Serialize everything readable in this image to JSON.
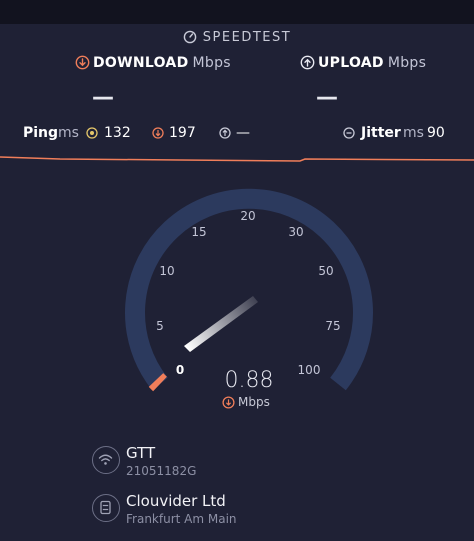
{
  "brand": {
    "icon": "gauge-icon",
    "label": "SPEEDTEST"
  },
  "download": {
    "icon": "download-arrow-icon",
    "label": "DOWNLOAD",
    "unit": "Mbps",
    "value": "—",
    "color": "#f07e5a"
  },
  "upload": {
    "icon": "upload-arrow-icon",
    "label": "UPLOAD",
    "unit": "Mbps",
    "value": "—"
  },
  "ping": {
    "label": "Ping",
    "unit": "ms",
    "idle": {
      "icon": "idle-latency-icon",
      "value": "132",
      "color": "#e4c66a"
    },
    "download": {
      "icon": "download-latency-icon",
      "value": "197",
      "color": "#f07e5a"
    },
    "upload": {
      "icon": "upload-latency-icon",
      "value": "—"
    }
  },
  "jitter": {
    "icon": "jitter-icon",
    "label": "Jitter",
    "unit": "ms",
    "value": "90"
  },
  "gauge": {
    "ticks": [
      "0",
      "5",
      "10",
      "15",
      "20",
      "30",
      "50",
      "75",
      "100"
    ],
    "speed": "0.88",
    "unit": "Mbps",
    "accent": "#f07e5a",
    "track": "#2c3a5e"
  },
  "server": {
    "isp": {
      "icon": "wifi-icon",
      "name": "GTT",
      "sub": "21051182G"
    },
    "host": {
      "icon": "server-icon",
      "name": "Clouvider Ltd",
      "sub": "Frankfurt Am Main"
    }
  }
}
